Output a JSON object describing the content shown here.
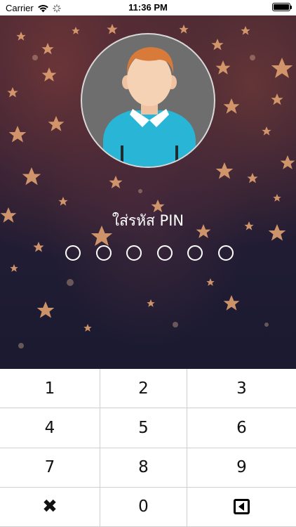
{
  "status_bar": {
    "carrier": "Carrier",
    "time": "11:36 PM"
  },
  "pin": {
    "title": "ใส่รหัส PIN",
    "length": 6,
    "entered": 0
  },
  "keypad": {
    "keys": [
      "1",
      "2",
      "3",
      "4",
      "5",
      "6",
      "7",
      "8",
      "9",
      "✖",
      "0",
      "backspace"
    ]
  },
  "icons": {
    "wifi": "wifi-icon",
    "activity": "activity-spinner-icon",
    "battery": "battery-icon",
    "avatar": "user-avatar-icon",
    "clear": "close-icon",
    "backspace": "backspace-icon"
  },
  "colors": {
    "background_top": "#3b2232",
    "background_bottom": "#1b1a30",
    "star": "#e0a070",
    "avatar_bg": "#6e6e6e",
    "shirt": "#29b6d6",
    "collar": "#ffffff",
    "skin": "#f6d2b4",
    "hair": "#d87a3a",
    "pin_dot": "#ffffff",
    "key_divider": "#cfcfcf"
  }
}
